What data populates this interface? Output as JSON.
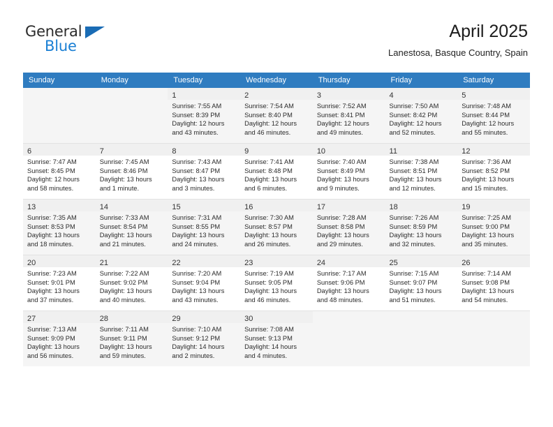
{
  "brand": {
    "name_part1": "General",
    "name_part2": "Blue",
    "triangle_color": "#1a6cb5",
    "blue_color": "#1a7fd4"
  },
  "header": {
    "title": "April 2025",
    "subtitle": "Lanestosa, Basque Country, Spain"
  },
  "theme": {
    "header_bg": "#2f7cc0",
    "header_text": "#ffffff",
    "shaded_row_bg": "#f5f5f5",
    "daynum_bg": "#f0f0f0"
  },
  "weekdays": [
    "Sunday",
    "Monday",
    "Tuesday",
    "Wednesday",
    "Thursday",
    "Friday",
    "Saturday"
  ],
  "weeks": [
    {
      "shaded": true,
      "days": [
        {
          "num": "",
          "lines": []
        },
        {
          "num": "",
          "lines": []
        },
        {
          "num": "1",
          "lines": [
            "Sunrise: 7:55 AM",
            "Sunset: 8:39 PM",
            "Daylight: 12 hours",
            "and 43 minutes."
          ]
        },
        {
          "num": "2",
          "lines": [
            "Sunrise: 7:54 AM",
            "Sunset: 8:40 PM",
            "Daylight: 12 hours",
            "and 46 minutes."
          ]
        },
        {
          "num": "3",
          "lines": [
            "Sunrise: 7:52 AM",
            "Sunset: 8:41 PM",
            "Daylight: 12 hours",
            "and 49 minutes."
          ]
        },
        {
          "num": "4",
          "lines": [
            "Sunrise: 7:50 AM",
            "Sunset: 8:42 PM",
            "Daylight: 12 hours",
            "and 52 minutes."
          ]
        },
        {
          "num": "5",
          "lines": [
            "Sunrise: 7:48 AM",
            "Sunset: 8:44 PM",
            "Daylight: 12 hours",
            "and 55 minutes."
          ]
        }
      ]
    },
    {
      "shaded": false,
      "days": [
        {
          "num": "6",
          "lines": [
            "Sunrise: 7:47 AM",
            "Sunset: 8:45 PM",
            "Daylight: 12 hours",
            "and 58 minutes."
          ]
        },
        {
          "num": "7",
          "lines": [
            "Sunrise: 7:45 AM",
            "Sunset: 8:46 PM",
            "Daylight: 13 hours",
            "and 1 minute."
          ]
        },
        {
          "num": "8",
          "lines": [
            "Sunrise: 7:43 AM",
            "Sunset: 8:47 PM",
            "Daylight: 13 hours",
            "and 3 minutes."
          ]
        },
        {
          "num": "9",
          "lines": [
            "Sunrise: 7:41 AM",
            "Sunset: 8:48 PM",
            "Daylight: 13 hours",
            "and 6 minutes."
          ]
        },
        {
          "num": "10",
          "lines": [
            "Sunrise: 7:40 AM",
            "Sunset: 8:49 PM",
            "Daylight: 13 hours",
            "and 9 minutes."
          ]
        },
        {
          "num": "11",
          "lines": [
            "Sunrise: 7:38 AM",
            "Sunset: 8:51 PM",
            "Daylight: 13 hours",
            "and 12 minutes."
          ]
        },
        {
          "num": "12",
          "lines": [
            "Sunrise: 7:36 AM",
            "Sunset: 8:52 PM",
            "Daylight: 13 hours",
            "and 15 minutes."
          ]
        }
      ]
    },
    {
      "shaded": true,
      "days": [
        {
          "num": "13",
          "lines": [
            "Sunrise: 7:35 AM",
            "Sunset: 8:53 PM",
            "Daylight: 13 hours",
            "and 18 minutes."
          ]
        },
        {
          "num": "14",
          "lines": [
            "Sunrise: 7:33 AM",
            "Sunset: 8:54 PM",
            "Daylight: 13 hours",
            "and 21 minutes."
          ]
        },
        {
          "num": "15",
          "lines": [
            "Sunrise: 7:31 AM",
            "Sunset: 8:55 PM",
            "Daylight: 13 hours",
            "and 24 minutes."
          ]
        },
        {
          "num": "16",
          "lines": [
            "Sunrise: 7:30 AM",
            "Sunset: 8:57 PM",
            "Daylight: 13 hours",
            "and 26 minutes."
          ]
        },
        {
          "num": "17",
          "lines": [
            "Sunrise: 7:28 AM",
            "Sunset: 8:58 PM",
            "Daylight: 13 hours",
            "and 29 minutes."
          ]
        },
        {
          "num": "18",
          "lines": [
            "Sunrise: 7:26 AM",
            "Sunset: 8:59 PM",
            "Daylight: 13 hours",
            "and 32 minutes."
          ]
        },
        {
          "num": "19",
          "lines": [
            "Sunrise: 7:25 AM",
            "Sunset: 9:00 PM",
            "Daylight: 13 hours",
            "and 35 minutes."
          ]
        }
      ]
    },
    {
      "shaded": false,
      "days": [
        {
          "num": "20",
          "lines": [
            "Sunrise: 7:23 AM",
            "Sunset: 9:01 PM",
            "Daylight: 13 hours",
            "and 37 minutes."
          ]
        },
        {
          "num": "21",
          "lines": [
            "Sunrise: 7:22 AM",
            "Sunset: 9:02 PM",
            "Daylight: 13 hours",
            "and 40 minutes."
          ]
        },
        {
          "num": "22",
          "lines": [
            "Sunrise: 7:20 AM",
            "Sunset: 9:04 PM",
            "Daylight: 13 hours",
            "and 43 minutes."
          ]
        },
        {
          "num": "23",
          "lines": [
            "Sunrise: 7:19 AM",
            "Sunset: 9:05 PM",
            "Daylight: 13 hours",
            "and 46 minutes."
          ]
        },
        {
          "num": "24",
          "lines": [
            "Sunrise: 7:17 AM",
            "Sunset: 9:06 PM",
            "Daylight: 13 hours",
            "and 48 minutes."
          ]
        },
        {
          "num": "25",
          "lines": [
            "Sunrise: 7:15 AM",
            "Sunset: 9:07 PM",
            "Daylight: 13 hours",
            "and 51 minutes."
          ]
        },
        {
          "num": "26",
          "lines": [
            "Sunrise: 7:14 AM",
            "Sunset: 9:08 PM",
            "Daylight: 13 hours",
            "and 54 minutes."
          ]
        }
      ]
    },
    {
      "shaded": true,
      "days": [
        {
          "num": "27",
          "lines": [
            "Sunrise: 7:13 AM",
            "Sunset: 9:09 PM",
            "Daylight: 13 hours",
            "and 56 minutes."
          ]
        },
        {
          "num": "28",
          "lines": [
            "Sunrise: 7:11 AM",
            "Sunset: 9:11 PM",
            "Daylight: 13 hours",
            "and 59 minutes."
          ]
        },
        {
          "num": "29",
          "lines": [
            "Sunrise: 7:10 AM",
            "Sunset: 9:12 PM",
            "Daylight: 14 hours",
            "and 2 minutes."
          ]
        },
        {
          "num": "30",
          "lines": [
            "Sunrise: 7:08 AM",
            "Sunset: 9:13 PM",
            "Daylight: 14 hours",
            "and 4 minutes."
          ]
        },
        {
          "num": "",
          "lines": []
        },
        {
          "num": "",
          "lines": []
        },
        {
          "num": "",
          "lines": []
        }
      ]
    }
  ]
}
